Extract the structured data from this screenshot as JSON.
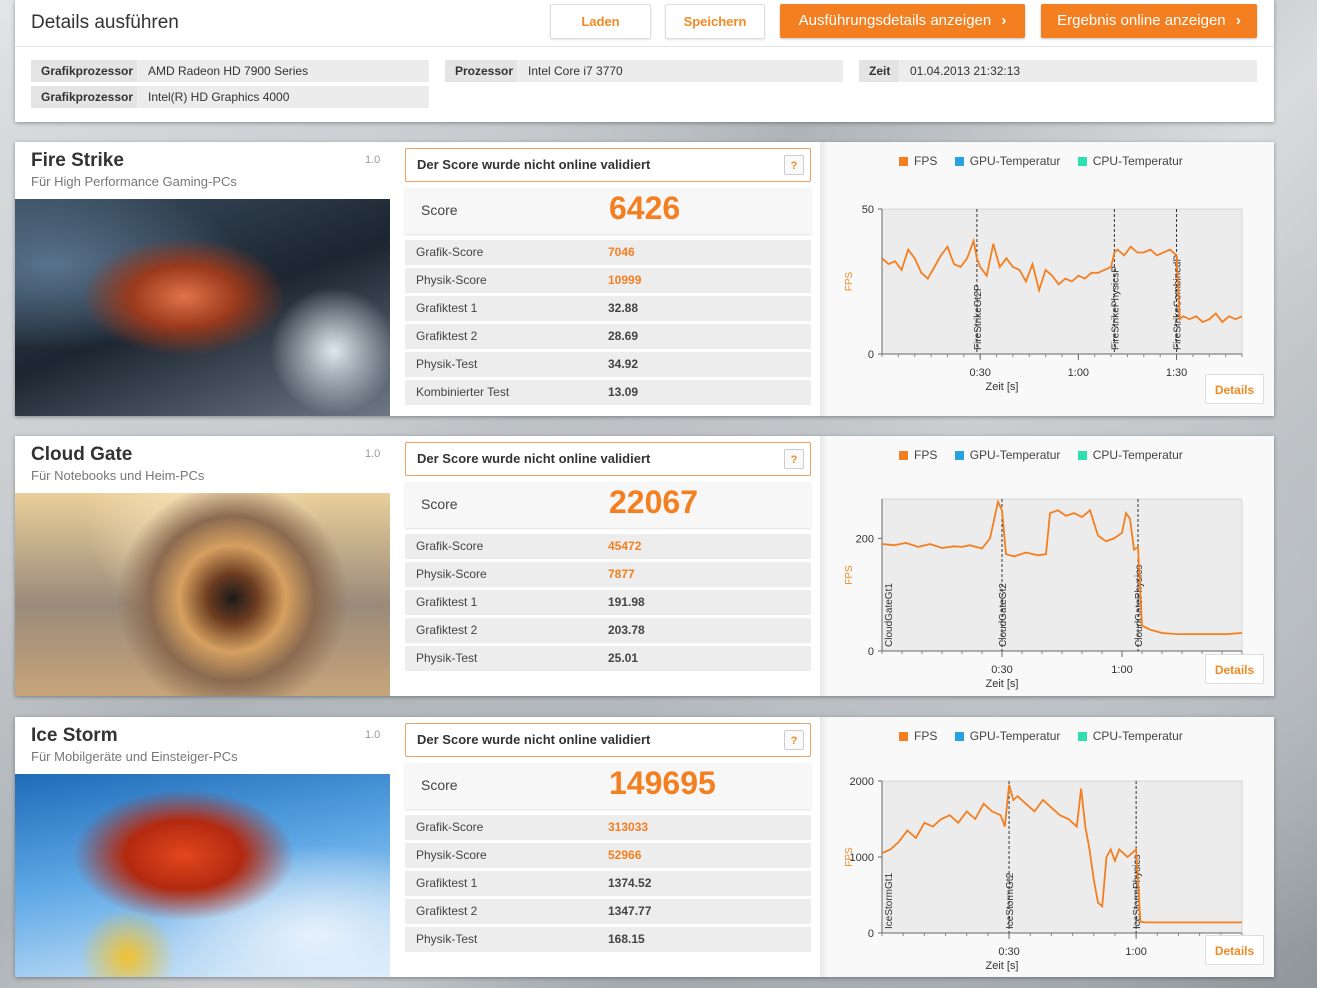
{
  "header": {
    "title": "Details ausführen",
    "load_label": "Laden",
    "save_label": "Speichern",
    "run_details_label": "Ausführungsdetails anzeigen",
    "online_label": "Ergebnis online anzeigen",
    "system": {
      "gpu_label": "Grafikprozessor",
      "gpu1": "AMD Radeon HD 7900 Series",
      "gpu2": "Intel(R) HD Graphics 4000",
      "cpu_label": "Prozessor",
      "cpu": "Intel Core i7 3770",
      "time_label": "Zeit",
      "time": "01.04.2013 21:32:13"
    }
  },
  "common": {
    "validate_text": "Der Score wurde nicht online validiert",
    "help": "?",
    "score_label": "Score",
    "details_label": "Details",
    "legend_fps": "FPS",
    "legend_gpu": "GPU-Temperatur",
    "legend_cpu": "CPU-Temperatur",
    "ylabel": "FPS",
    "xlabel": "Zeit [s]",
    "fps_color": "#f47f20",
    "gpu_color": "#29a3e0",
    "cpu_color": "#2ee0b0"
  },
  "tests": [
    {
      "name": "Fire Strike",
      "subtitle": "Für High Performance Gaming-PCs",
      "version": "1.0",
      "score": "6426",
      "rows": [
        {
          "label": "Grafik-Score",
          "value": "7046",
          "highlight": true
        },
        {
          "label": "Physik-Score",
          "value": "10999",
          "highlight": true
        },
        {
          "label": "Grafiktest 1",
          "value": "32.88",
          "highlight": false
        },
        {
          "label": "Grafiktest 2",
          "value": "28.69",
          "highlight": false
        },
        {
          "label": "Physik-Test",
          "value": "34.92",
          "highlight": false
        },
        {
          "label": "Kombinierter Test",
          "value": "13.09",
          "highlight": false
        }
      ]
    },
    {
      "name": "Cloud Gate",
      "subtitle": "Für Notebooks und Heim-PCs",
      "version": "1.0",
      "score": "22067",
      "rows": [
        {
          "label": "Grafik-Score",
          "value": "45472",
          "highlight": true
        },
        {
          "label": "Physik-Score",
          "value": "7877",
          "highlight": true
        },
        {
          "label": "Grafiktest 1",
          "value": "191.98",
          "highlight": false
        },
        {
          "label": "Grafiktest 2",
          "value": "203.78",
          "highlight": false
        },
        {
          "label": "Physik-Test",
          "value": "25.01",
          "highlight": false
        }
      ]
    },
    {
      "name": "Ice Storm",
      "subtitle": "Für Mobilgeräte und Einsteiger-PCs",
      "version": "1.0",
      "score": "149695",
      "rows": [
        {
          "label": "Grafik-Score",
          "value": "313033",
          "highlight": true
        },
        {
          "label": "Physik-Score",
          "value": "52966",
          "highlight": true
        },
        {
          "label": "Grafiktest 1",
          "value": "1374.52",
          "highlight": false
        },
        {
          "label": "Grafiktest 2",
          "value": "1347.77",
          "highlight": false
        },
        {
          "label": "Physik-Test",
          "value": "168.15",
          "highlight": false
        }
      ]
    }
  ],
  "chart_data": [
    {
      "type": "line",
      "xlabel": "Zeit [s]",
      "ylabel": "FPS",
      "xlim": [
        0,
        110
      ],
      "ylim": [
        0,
        50
      ],
      "xticks": [
        "0:30",
        "1:00",
        "1:30"
      ],
      "xtick_values": [
        30,
        60,
        90
      ],
      "yticks": [
        0,
        50
      ],
      "markers": [
        {
          "label": "FireStrikeGt2P",
          "x": 29
        },
        {
          "label": "FireStrikePhysicsP",
          "x": 71
        },
        {
          "label": "FireStrikeCombinedP",
          "x": 90
        }
      ],
      "series": [
        {
          "name": "FPS",
          "x": [
            0,
            2,
            4,
            6,
            8,
            10,
            12,
            14,
            16,
            18,
            20,
            22,
            24,
            26,
            28,
            29,
            30,
            32,
            34,
            36,
            38,
            40,
            42,
            44,
            46,
            48,
            50,
            52,
            54,
            56,
            58,
            60,
            62,
            64,
            66,
            68,
            70,
            71,
            72,
            74,
            76,
            78,
            80,
            82,
            84,
            86,
            88,
            90,
            91,
            92,
            94,
            96,
            98,
            100,
            102,
            104,
            106,
            108,
            110
          ],
          "y": [
            33,
            31,
            32,
            29,
            36,
            33,
            28,
            26,
            30,
            34,
            37,
            31,
            30,
            33,
            39,
            33,
            30,
            27,
            38,
            30,
            33,
            30,
            29,
            25,
            31,
            22,
            29,
            27,
            24,
            26,
            25,
            27,
            26,
            28,
            28,
            29,
            30,
            35,
            36,
            34,
            37,
            35,
            35,
            36,
            34,
            35,
            36,
            34,
            12,
            13,
            12,
            13,
            11,
            12,
            14,
            11,
            13,
            12,
            13
          ]
        }
      ]
    },
    {
      "type": "line",
      "xlabel": "Zeit [s]",
      "ylabel": "FPS",
      "xlim": [
        0,
        90
      ],
      "ylim": [
        0,
        270
      ],
      "xticks": [
        "0:30",
        "1:00"
      ],
      "xtick_values": [
        30,
        60
      ],
      "yticks": [
        0,
        200
      ],
      "markers": [
        {
          "label": "CloudGateGt1",
          "x": 0
        },
        {
          "label": "CloudGateGt2",
          "x": 30
        },
        {
          "label": "CloudGatePhysics",
          "x": 64
        }
      ],
      "series": [
        {
          "name": "FPS",
          "x": [
            0,
            3,
            6,
            9,
            12,
            15,
            18,
            20,
            22,
            25,
            27,
            29,
            30,
            31,
            33,
            36,
            39,
            41,
            42,
            44,
            46,
            48,
            50,
            52,
            54,
            56,
            58,
            60,
            61,
            62,
            63,
            64,
            65,
            67,
            70,
            74,
            78,
            82,
            86,
            90
          ],
          "y": [
            190,
            188,
            192,
            185,
            190,
            183,
            186,
            185,
            188,
            182,
            200,
            265,
            250,
            172,
            168,
            175,
            170,
            172,
            245,
            250,
            240,
            245,
            238,
            250,
            205,
            195,
            200,
            210,
            245,
            235,
            180,
            185,
            45,
            38,
            32,
            30,
            30,
            30,
            30,
            32
          ]
        }
      ]
    },
    {
      "type": "line",
      "xlabel": "Zeit [s]",
      "ylabel": "FPS",
      "xlim": [
        0,
        85
      ],
      "ylim": [
        0,
        2000
      ],
      "xticks": [
        "0:30",
        "1:00"
      ],
      "xtick_values": [
        30,
        60
      ],
      "yticks": [
        0,
        1000,
        2000
      ],
      "markers": [
        {
          "label": "IceStormGt1",
          "x": 0
        },
        {
          "label": "IceStormGt2",
          "x": 30
        },
        {
          "label": "IceStormPhysics",
          "x": 60
        }
      ],
      "series": [
        {
          "name": "FPS",
          "x": [
            0,
            2,
            4,
            6,
            8,
            10,
            12,
            14,
            16,
            18,
            20,
            22,
            24,
            26,
            28,
            29,
            30,
            31,
            32,
            34,
            36,
            38,
            40,
            42,
            44,
            46,
            47,
            48,
            49,
            50,
            51,
            52,
            53,
            54,
            55,
            56,
            58,
            60,
            61,
            62,
            64,
            66,
            70,
            75,
            80,
            85
          ],
          "y": [
            1050,
            1100,
            1200,
            1350,
            1250,
            1450,
            1400,
            1500,
            1550,
            1450,
            1600,
            1500,
            1700,
            1600,
            1550,
            1400,
            1950,
            1750,
            1800,
            1700,
            1600,
            1750,
            1650,
            1550,
            1500,
            1400,
            1900,
            1400,
            1100,
            700,
            400,
            350,
            1000,
            1100,
            950,
            1100,
            1000,
            1100,
            150,
            140,
            140,
            140,
            140,
            140,
            140,
            140
          ]
        }
      ]
    }
  ]
}
